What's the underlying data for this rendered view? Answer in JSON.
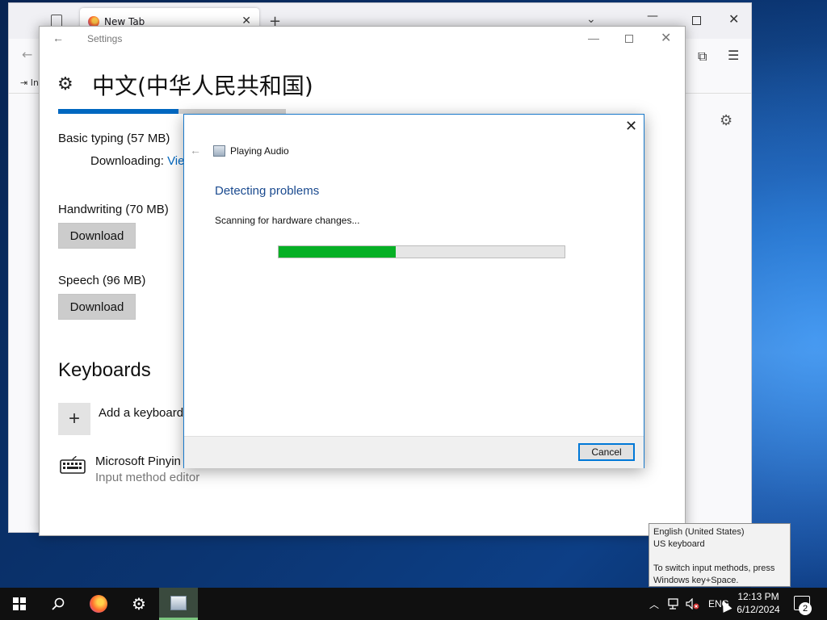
{
  "browser": {
    "tab_title": "New Tab",
    "bookmark_label": "In"
  },
  "settings": {
    "window_title": "Settings",
    "page_heading": "中文(中华人民共和国)",
    "download_progress": 0.53,
    "basic_typing": {
      "label": "Basic typing (57 MB)",
      "status_prefix": "Downloading:",
      "status_link": "Vie"
    },
    "handwriting": {
      "label": "Handwriting (70 MB)",
      "button": "Download"
    },
    "speech": {
      "label": "Speech (96 MB)",
      "button": "Download"
    },
    "keyboards_heading": "Keyboards",
    "add_keyboard_label": "Add a keyboard",
    "keyboard_item": {
      "name": "Microsoft Pinyin",
      "description": "Input method editor"
    }
  },
  "dialog": {
    "app_title": "Playing Audio",
    "status_title": "Detecting problems",
    "status_message": "Scanning for hardware changes...",
    "progress": 0.41,
    "cancel_label": "Cancel"
  },
  "tooltip": {
    "line1": "English (United States)",
    "line2": "US keyboard",
    "line3": "To switch input methods, press",
    "line4": "Windows key+Space."
  },
  "taskbar": {
    "language": "ENG",
    "time": "12:13 PM",
    "date": "6/12/2024",
    "notification_count": "2",
    "accent": "#7cc67f"
  },
  "colors": {
    "dialog_progress": "#06b025",
    "settings_progress": "#0067c0",
    "status_title": "#1a4a8f"
  }
}
